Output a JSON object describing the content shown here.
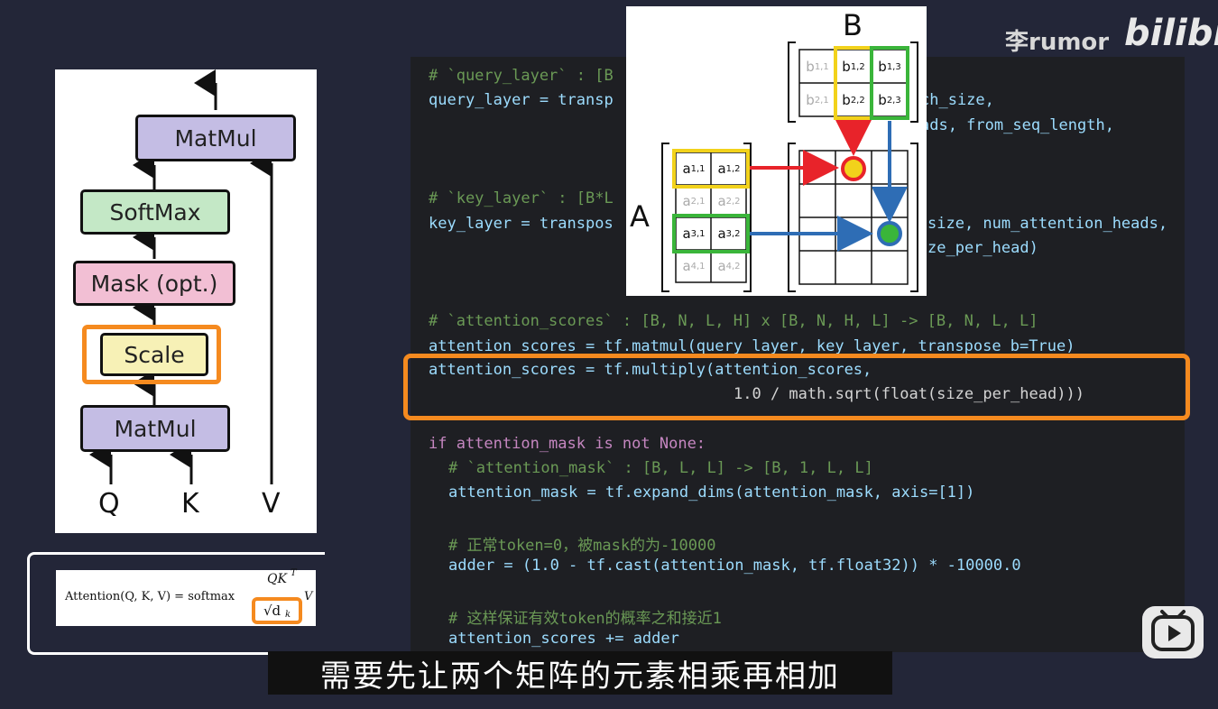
{
  "watermark": {
    "user": "李rumor",
    "brand": "bilibili"
  },
  "diagram": {
    "blocks": {
      "matmul_top": "MatMul",
      "softmax": "SoftMax",
      "mask": "Mask (opt.)",
      "scale": "Scale",
      "matmul_bottom": "MatMul"
    },
    "inputs": {
      "q": "Q",
      "k": "K",
      "v": "V"
    }
  },
  "formula": {
    "lhs": "Attention(Q, K, V) = softmax",
    "numerator": "QK",
    "sup": "T",
    "denominator": "√d",
    "sub": "k",
    "tail": "V"
  },
  "matrix_illustration": {
    "label_a": "A",
    "label_b": "B",
    "a_cells": [
      [
        "a",
        "1,1"
      ],
      [
        "a",
        "1,2"
      ],
      [
        "a",
        "2,1"
      ],
      [
        "a",
        "2,2"
      ],
      [
        "a",
        "3,1"
      ],
      [
        "a",
        "3,2"
      ],
      [
        "a",
        "4,1"
      ],
      [
        "a",
        "4,2"
      ]
    ],
    "b_cells": [
      [
        "b",
        "1,1"
      ],
      [
        "b",
        "1,2"
      ],
      [
        "b",
        "1,3"
      ],
      [
        "b",
        "2,1"
      ],
      [
        "b",
        "2,2"
      ],
      [
        "b",
        "2,3"
      ]
    ]
  },
  "code": {
    "l1_comment": "# `query_layer` : [B",
    "l2": "query_layer = transp",
    "l2_tail": "ch_size,",
    "l3_tail": "ads, from_seq_length,",
    "l4_comment": "# `key_layer` : [B*L",
    "l5": "key_layer = transpos",
    "l5_tail": "size, num_attention_heads,",
    "l6_tail": "ze_per_head)",
    "l7_comment": "# `attention_scores` : [B, N, L, H] x [B, N, H, L] -> [B, N, L, L]",
    "l8": "attention_scores = tf.matmul(query_layer, key_layer, transpose_b=True)",
    "l9": "attention_scores = tf.multiply(attention_scores,",
    "l10": "1.0 / math.sqrt(float(size_per_head)))",
    "l11": "if attention_mask is not None:",
    "l12_comment": "# `attention_mask` : [B, L, L] -> [B, 1, L, L]",
    "l13": "attention_mask = tf.expand_dims(attention_mask, axis=[1])",
    "l14_comment": "# 正常token=0，被mask的为-10000",
    "l15": "adder = (1.0 - tf.cast(attention_mask, tf.float32)) * -10000.0",
    "l16_comment": "# 这样保证有效token的概率之和接近1",
    "l17": "attention_scores += adder"
  },
  "subtitle": "需要先让两个矩阵的元素相乘再相加",
  "colors": {
    "highlight": "#f58a1f",
    "arrow_red": "#e8232a",
    "arrow_blue": "#2e6db5",
    "yellow_box": "#f2d21b",
    "green_box": "#3ab53a"
  }
}
